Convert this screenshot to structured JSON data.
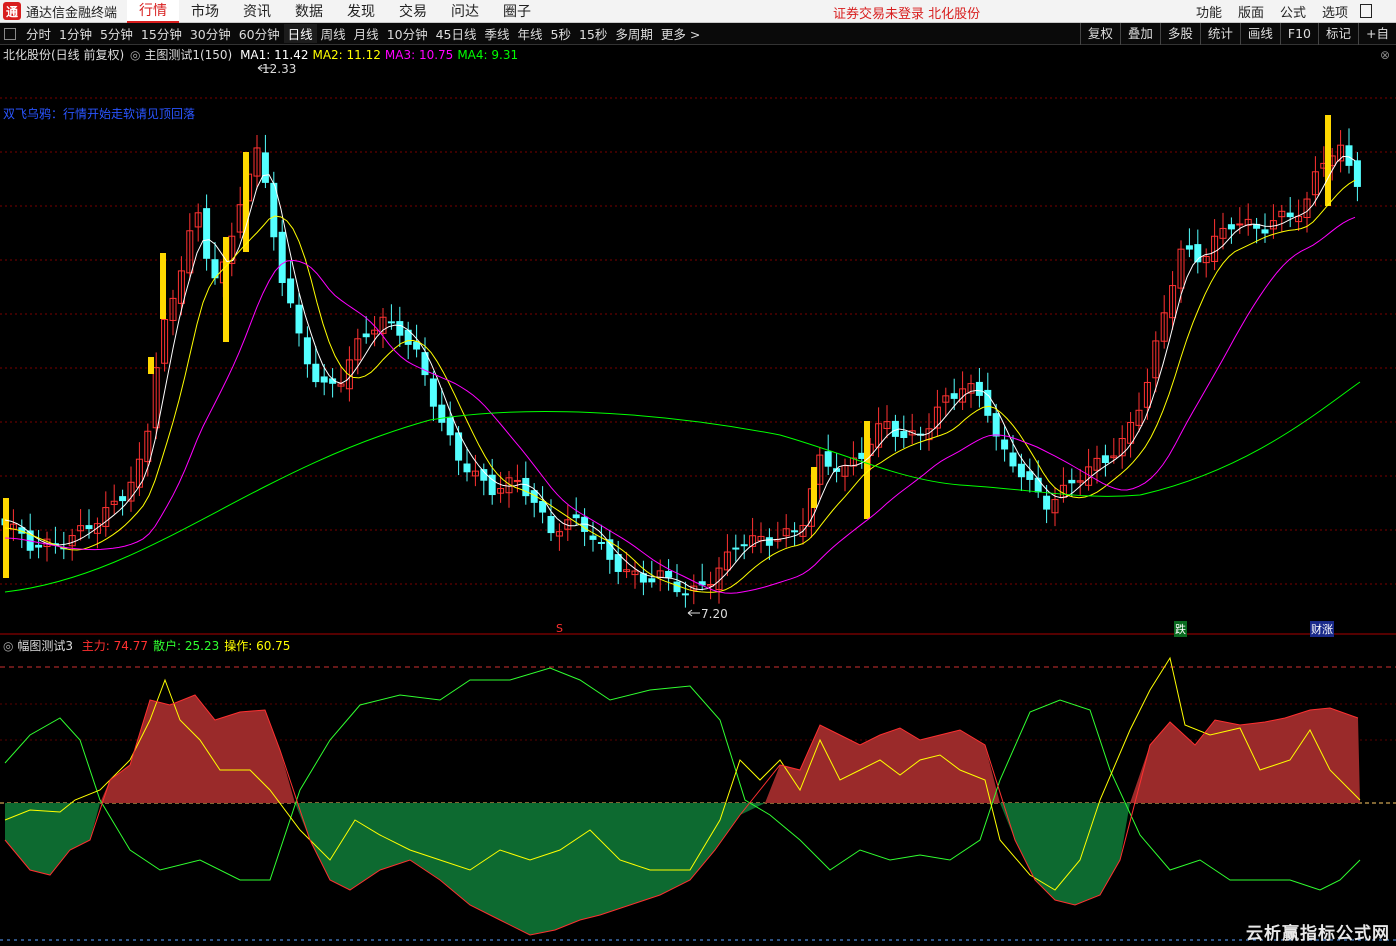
{
  "app": {
    "logo_char": "通",
    "name": "通达信金融终端"
  },
  "top_menu": [
    "行情",
    "市场",
    "资讯",
    "数据",
    "发现",
    "交易",
    "问达",
    "圈子"
  ],
  "top_menu_active": 0,
  "notice": "证券交易未登录  北化股份",
  "right_menu": [
    "功能",
    "版面",
    "公式",
    "选项"
  ],
  "periods": [
    "分时",
    "1分钟",
    "5分钟",
    "15分钟",
    "30分钟",
    "60分钟",
    "日线",
    "周线",
    "月线",
    "10分钟",
    "45日线",
    "季线",
    "年线",
    "5秒",
    "15秒",
    "多周期",
    "更多 >"
  ],
  "period_selected": 6,
  "tools": [
    "复权",
    "叠加",
    "多股",
    "统计",
    "画线",
    "F10",
    "标记",
    "+自"
  ],
  "main_panel": {
    "title": "北化股份(日线 前复权)",
    "indicator": "主图测试1(150)",
    "ma": [
      {
        "label": "MA1: 11.42",
        "color": "#ffffff"
      },
      {
        "label": "MA2: 11.12",
        "color": "#ffff00"
      },
      {
        "label": "MA3: 10.75",
        "color": "#ff00ff"
      },
      {
        "label": "MA4: 9.31",
        "color": "#00ff00"
      }
    ],
    "high_label": "12.33",
    "low_label": "7.20",
    "signal_text": "双飞乌鸦：行情开始走软请见顶回落",
    "markers": {
      "s": "S",
      "fall": "跌",
      "rise": "财涨"
    }
  },
  "sub_panel": {
    "title": "幅图测试3",
    "values": [
      {
        "label": "主力: 74.77",
        "color": "#ff3030"
      },
      {
        "label": "散户: 25.23",
        "color": "#30ff30"
      },
      {
        "label": "操作: 60.75",
        "color": "#ffff00"
      }
    ]
  },
  "colors": {
    "up": "#ff3232",
    "down": "#54ffff",
    "ma1": "#ffffff",
    "ma2": "#ffff00",
    "ma3": "#ff00ff",
    "ma4": "#00ff00",
    "grid": "#7a0000"
  },
  "watermark": "云析赢指标公式网"
}
